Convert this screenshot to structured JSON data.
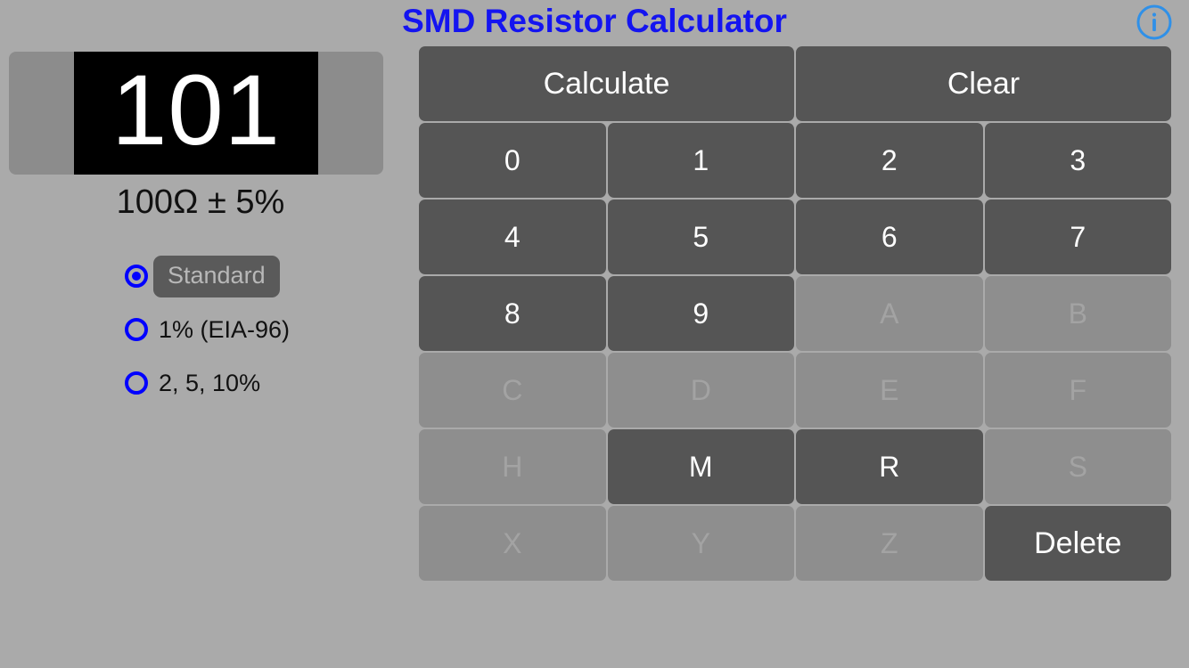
{
  "header": {
    "title": "SMD Resistor Calculator",
    "title_color": "#1414f0",
    "info_icon": "info-icon",
    "info_icon_color": "#2f90e8"
  },
  "display": {
    "resistor_code": "101",
    "resistor_body_color": "#000000",
    "resistor_terminal_color": "#8c8c8c",
    "resistance_value": "100Ω ± 5%"
  },
  "tolerance": {
    "accent_color": "#0000ff",
    "options": [
      {
        "label": "Standard",
        "selected": true,
        "highlighted": true
      },
      {
        "label": "1% (EIA-96)",
        "selected": false,
        "highlighted": false
      },
      {
        "label": "2, 5, 10%",
        "selected": false,
        "highlighted": false
      }
    ]
  },
  "keypad": {
    "enabled_color": "#555555",
    "enabled_text_color": "#ffffff",
    "disabled_color": "#8e8e8e",
    "disabled_text_color": "#a3a3a3",
    "rows": [
      [
        {
          "label": "Calculate",
          "name": "calculate-button",
          "enabled": true,
          "wide": true,
          "action": true
        },
        {
          "label": "Clear",
          "name": "clear-button",
          "enabled": true,
          "wide": true,
          "action": true
        }
      ],
      [
        {
          "label": "0",
          "name": "key-0",
          "enabled": true
        },
        {
          "label": "1",
          "name": "key-1",
          "enabled": true
        },
        {
          "label": "2",
          "name": "key-2",
          "enabled": true
        },
        {
          "label": "3",
          "name": "key-3",
          "enabled": true
        }
      ],
      [
        {
          "label": "4",
          "name": "key-4",
          "enabled": true
        },
        {
          "label": "5",
          "name": "key-5",
          "enabled": true
        },
        {
          "label": "6",
          "name": "key-6",
          "enabled": true
        },
        {
          "label": "7",
          "name": "key-7",
          "enabled": true
        }
      ],
      [
        {
          "label": "8",
          "name": "key-8",
          "enabled": true
        },
        {
          "label": "9",
          "name": "key-9",
          "enabled": true
        },
        {
          "label": "A",
          "name": "key-a",
          "enabled": false
        },
        {
          "label": "B",
          "name": "key-b",
          "enabled": false
        }
      ],
      [
        {
          "label": "C",
          "name": "key-c",
          "enabled": false
        },
        {
          "label": "D",
          "name": "key-d",
          "enabled": false
        },
        {
          "label": "E",
          "name": "key-e",
          "enabled": false
        },
        {
          "label": "F",
          "name": "key-f",
          "enabled": false
        }
      ],
      [
        {
          "label": "H",
          "name": "key-h",
          "enabled": false
        },
        {
          "label": "M",
          "name": "key-m",
          "enabled": true
        },
        {
          "label": "R",
          "name": "key-r",
          "enabled": true
        },
        {
          "label": "S",
          "name": "key-s",
          "enabled": false
        }
      ],
      [
        {
          "label": "X",
          "name": "key-x",
          "enabled": false
        },
        {
          "label": "Y",
          "name": "key-y",
          "enabled": false
        },
        {
          "label": "Z",
          "name": "key-z",
          "enabled": false
        },
        {
          "label": "Delete",
          "name": "delete-button",
          "enabled": true,
          "action": true
        }
      ]
    ]
  }
}
